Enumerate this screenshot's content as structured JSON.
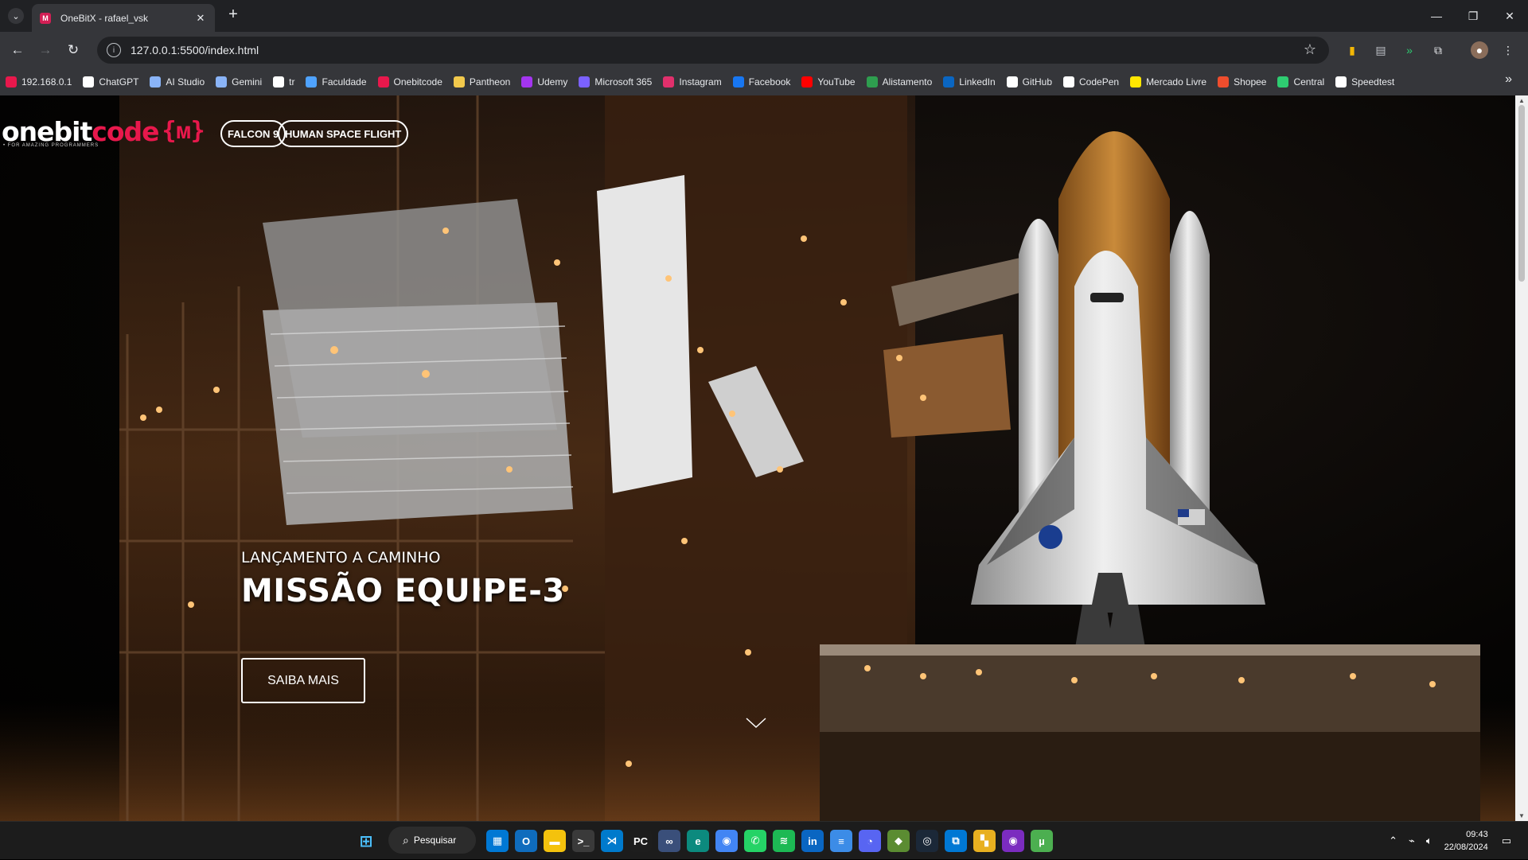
{
  "browser": {
    "tab_title": "OneBitX - rafael_vsk",
    "url": "127.0.0.1:5500/index.html"
  },
  "bookmarks": [
    {
      "label": "192.168.0.1",
      "icon": "router-icon",
      "color": "#e8184c"
    },
    {
      "label": "ChatGPT",
      "icon": "chatgpt-icon",
      "color": "#ffffff"
    },
    {
      "label": "AI Studio",
      "icon": "ai-studio-icon",
      "color": "#8ab4f8"
    },
    {
      "label": "Gemini",
      "icon": "gemini-icon",
      "color": "#8ab4f8"
    },
    {
      "label": "tr",
      "icon": "google-icon",
      "color": "#ffffff"
    },
    {
      "label": "Faculdade",
      "icon": "faculdade-icon",
      "color": "#4fa3ff"
    },
    {
      "label": "Onebitcode",
      "icon": "onebitcode-icon",
      "color": "#e8184c"
    },
    {
      "label": "Pantheon",
      "icon": "pantheon-icon",
      "color": "#f2c94c"
    },
    {
      "label": "Udemy",
      "icon": "udemy-icon",
      "color": "#a435f0"
    },
    {
      "label": "Microsoft 365",
      "icon": "microsoft365-icon",
      "color": "#7b61ff"
    },
    {
      "label": "Instagram",
      "icon": "instagram-icon",
      "color": "#e1306c"
    },
    {
      "label": "Facebook",
      "icon": "facebook-icon",
      "color": "#1877f2"
    },
    {
      "label": "YouTube",
      "icon": "youtube-icon",
      "color": "#ff0000"
    },
    {
      "label": "Alistamento",
      "icon": "alistamento-icon",
      "color": "#2e9e4f"
    },
    {
      "label": "LinkedIn",
      "icon": "linkedin-icon",
      "color": "#0a66c2"
    },
    {
      "label": "GitHub",
      "icon": "github-icon",
      "color": "#ffffff"
    },
    {
      "label": "CodePen",
      "icon": "codepen-icon",
      "color": "#ffffff"
    },
    {
      "label": "Mercado Livre",
      "icon": "mercadolivre-icon",
      "color": "#ffe600"
    },
    {
      "label": "Shopee",
      "icon": "shopee-icon",
      "color": "#ee4d2d"
    },
    {
      "label": "Central",
      "icon": "central-icon",
      "color": "#2ecc71"
    },
    {
      "label": "Speedtest",
      "icon": "speedtest-icon",
      "color": "#ffffff"
    }
  ],
  "site": {
    "logo_main": "onebit",
    "logo_accent": "code",
    "logo_mark": "{ᴍ}",
    "logo_tagline": "• FOR AMAZING PROGRAMMERS",
    "nav": [
      "FALCON 9",
      "HUMAN SPACE FLIGHT"
    ],
    "hero": {
      "kicker": "LANÇAMENTO A CAMINHO",
      "title": "MISSÃO EQUIPE-3",
      "button": "SAIBA MAIS"
    }
  },
  "taskbar": {
    "search_label": "Pesquisar",
    "time": "09:43",
    "date": "22/08/2024",
    "apps": [
      {
        "name": "store-icon",
        "color": "#0078d4",
        "glyph": "▦"
      },
      {
        "name": "outlook-icon",
        "color": "#0f6cbd",
        "glyph": "O"
      },
      {
        "name": "file-explorer-icon",
        "color": "#f4c20d",
        "glyph": "▬"
      },
      {
        "name": "terminal-icon",
        "color": "#3a3a3a",
        "glyph": ">_"
      },
      {
        "name": "vscode-icon",
        "color": "#007acc",
        "glyph": "⋊"
      },
      {
        "name": "pycharm-icon",
        "color": "#1d1d1d",
        "glyph": "PC"
      },
      {
        "name": "visual-studio-icon",
        "color": "#3a4f7a",
        "glyph": "∞"
      },
      {
        "name": "edge-icon",
        "color": "#0c8a7e",
        "glyph": "e"
      },
      {
        "name": "chrome-icon",
        "color": "#4285f4",
        "glyph": "◉"
      },
      {
        "name": "whatsapp-icon",
        "color": "#25d366",
        "glyph": "✆"
      },
      {
        "name": "spotify-icon",
        "color": "#1db954",
        "glyph": "≋"
      },
      {
        "name": "linkedin-app-icon",
        "color": "#0a66c2",
        "glyph": "in"
      },
      {
        "name": "notepad-icon",
        "color": "#3c8ce7",
        "glyph": "≡"
      },
      {
        "name": "discord-icon",
        "color": "#5865f2",
        "glyph": "◔"
      },
      {
        "name": "minecraft-icon",
        "color": "#5b8c32",
        "glyph": "◆"
      },
      {
        "name": "steam-icon",
        "color": "#1b2838",
        "glyph": "◎"
      },
      {
        "name": "remote-desktop-icon",
        "color": "#0078d4",
        "glyph": "⧉"
      },
      {
        "name": "game-launcher-icon",
        "color": "#e8b020",
        "glyph": "▚"
      },
      {
        "name": "purple-app-icon",
        "color": "#7b2cbf",
        "glyph": "◉"
      },
      {
        "name": "utorrent-icon",
        "color": "#4caf50",
        "glyph": "µ"
      }
    ]
  }
}
